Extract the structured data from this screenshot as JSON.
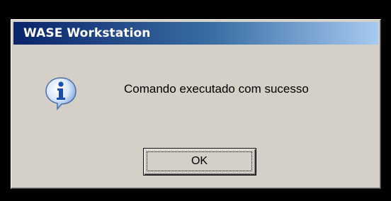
{
  "window": {
    "title": "WASE Workstation"
  },
  "dialog": {
    "icon": "information-icon",
    "message": "Comando executado com sucesso",
    "ok_label": "OK"
  },
  "colors": {
    "titlebar_start": "#0a246a",
    "titlebar_end": "#a6caf0",
    "dialog_background": "#d4d0c8"
  }
}
